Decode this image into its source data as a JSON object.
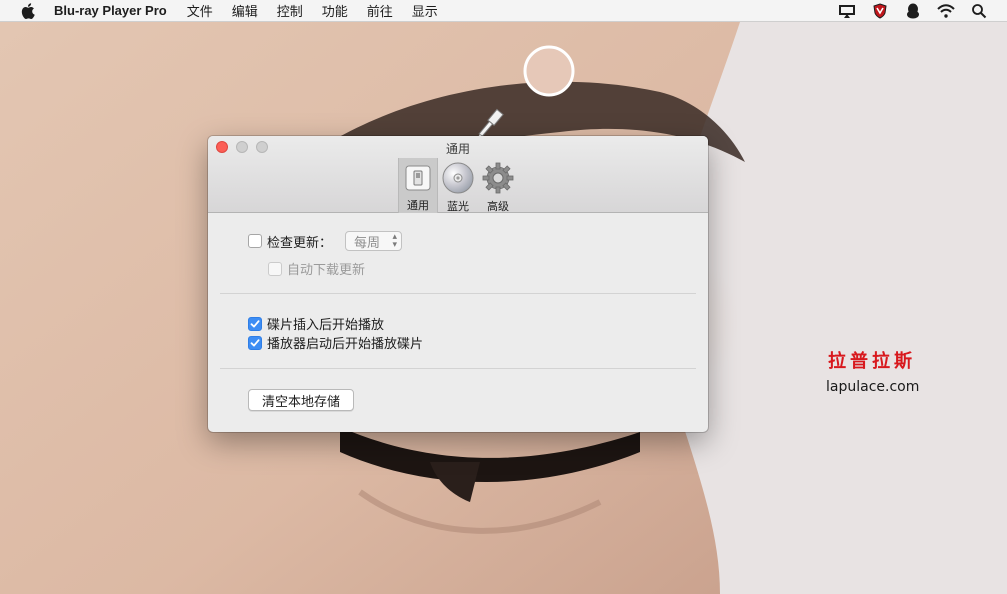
{
  "menubar": {
    "apple_icon": "apple-logo-icon",
    "app_name": "Blu-ray Player Pro",
    "menus": [
      "文件",
      "编辑",
      "控制",
      "功能",
      "前往",
      "显示"
    ],
    "status_icons": [
      "airplay-display-icon",
      "antivirus-shield-icon",
      "qq-penguin-icon",
      "wifi-icon",
      "search-icon"
    ]
  },
  "window": {
    "title": "通用",
    "toolbar": [
      {
        "label": "通用",
        "icon": "switch-icon",
        "selected": true
      },
      {
        "label": "蓝光",
        "icon": "disc-icon",
        "selected": false
      },
      {
        "label": "高级",
        "icon": "gear-icon",
        "selected": false
      }
    ],
    "check_updates": {
      "label": "检查更新：",
      "checked": false
    },
    "update_frequency": {
      "value": "每周"
    },
    "auto_download": {
      "label": "自动下载更新",
      "checked": false,
      "enabled": false
    },
    "play_on_insert": {
      "label": "碟片插入后开始播放",
      "checked": true
    },
    "play_on_launch": {
      "label": "播放器启动后开始播放碟片",
      "checked": true
    },
    "clear_storage_button": "清空本地存储"
  },
  "watermark": {
    "chinese": "拉普拉斯",
    "url": "lapulace.com"
  },
  "colors": {
    "accent": "#3d8df4",
    "close_light": "#fc5e56",
    "watermark_red": "#d8191e"
  }
}
